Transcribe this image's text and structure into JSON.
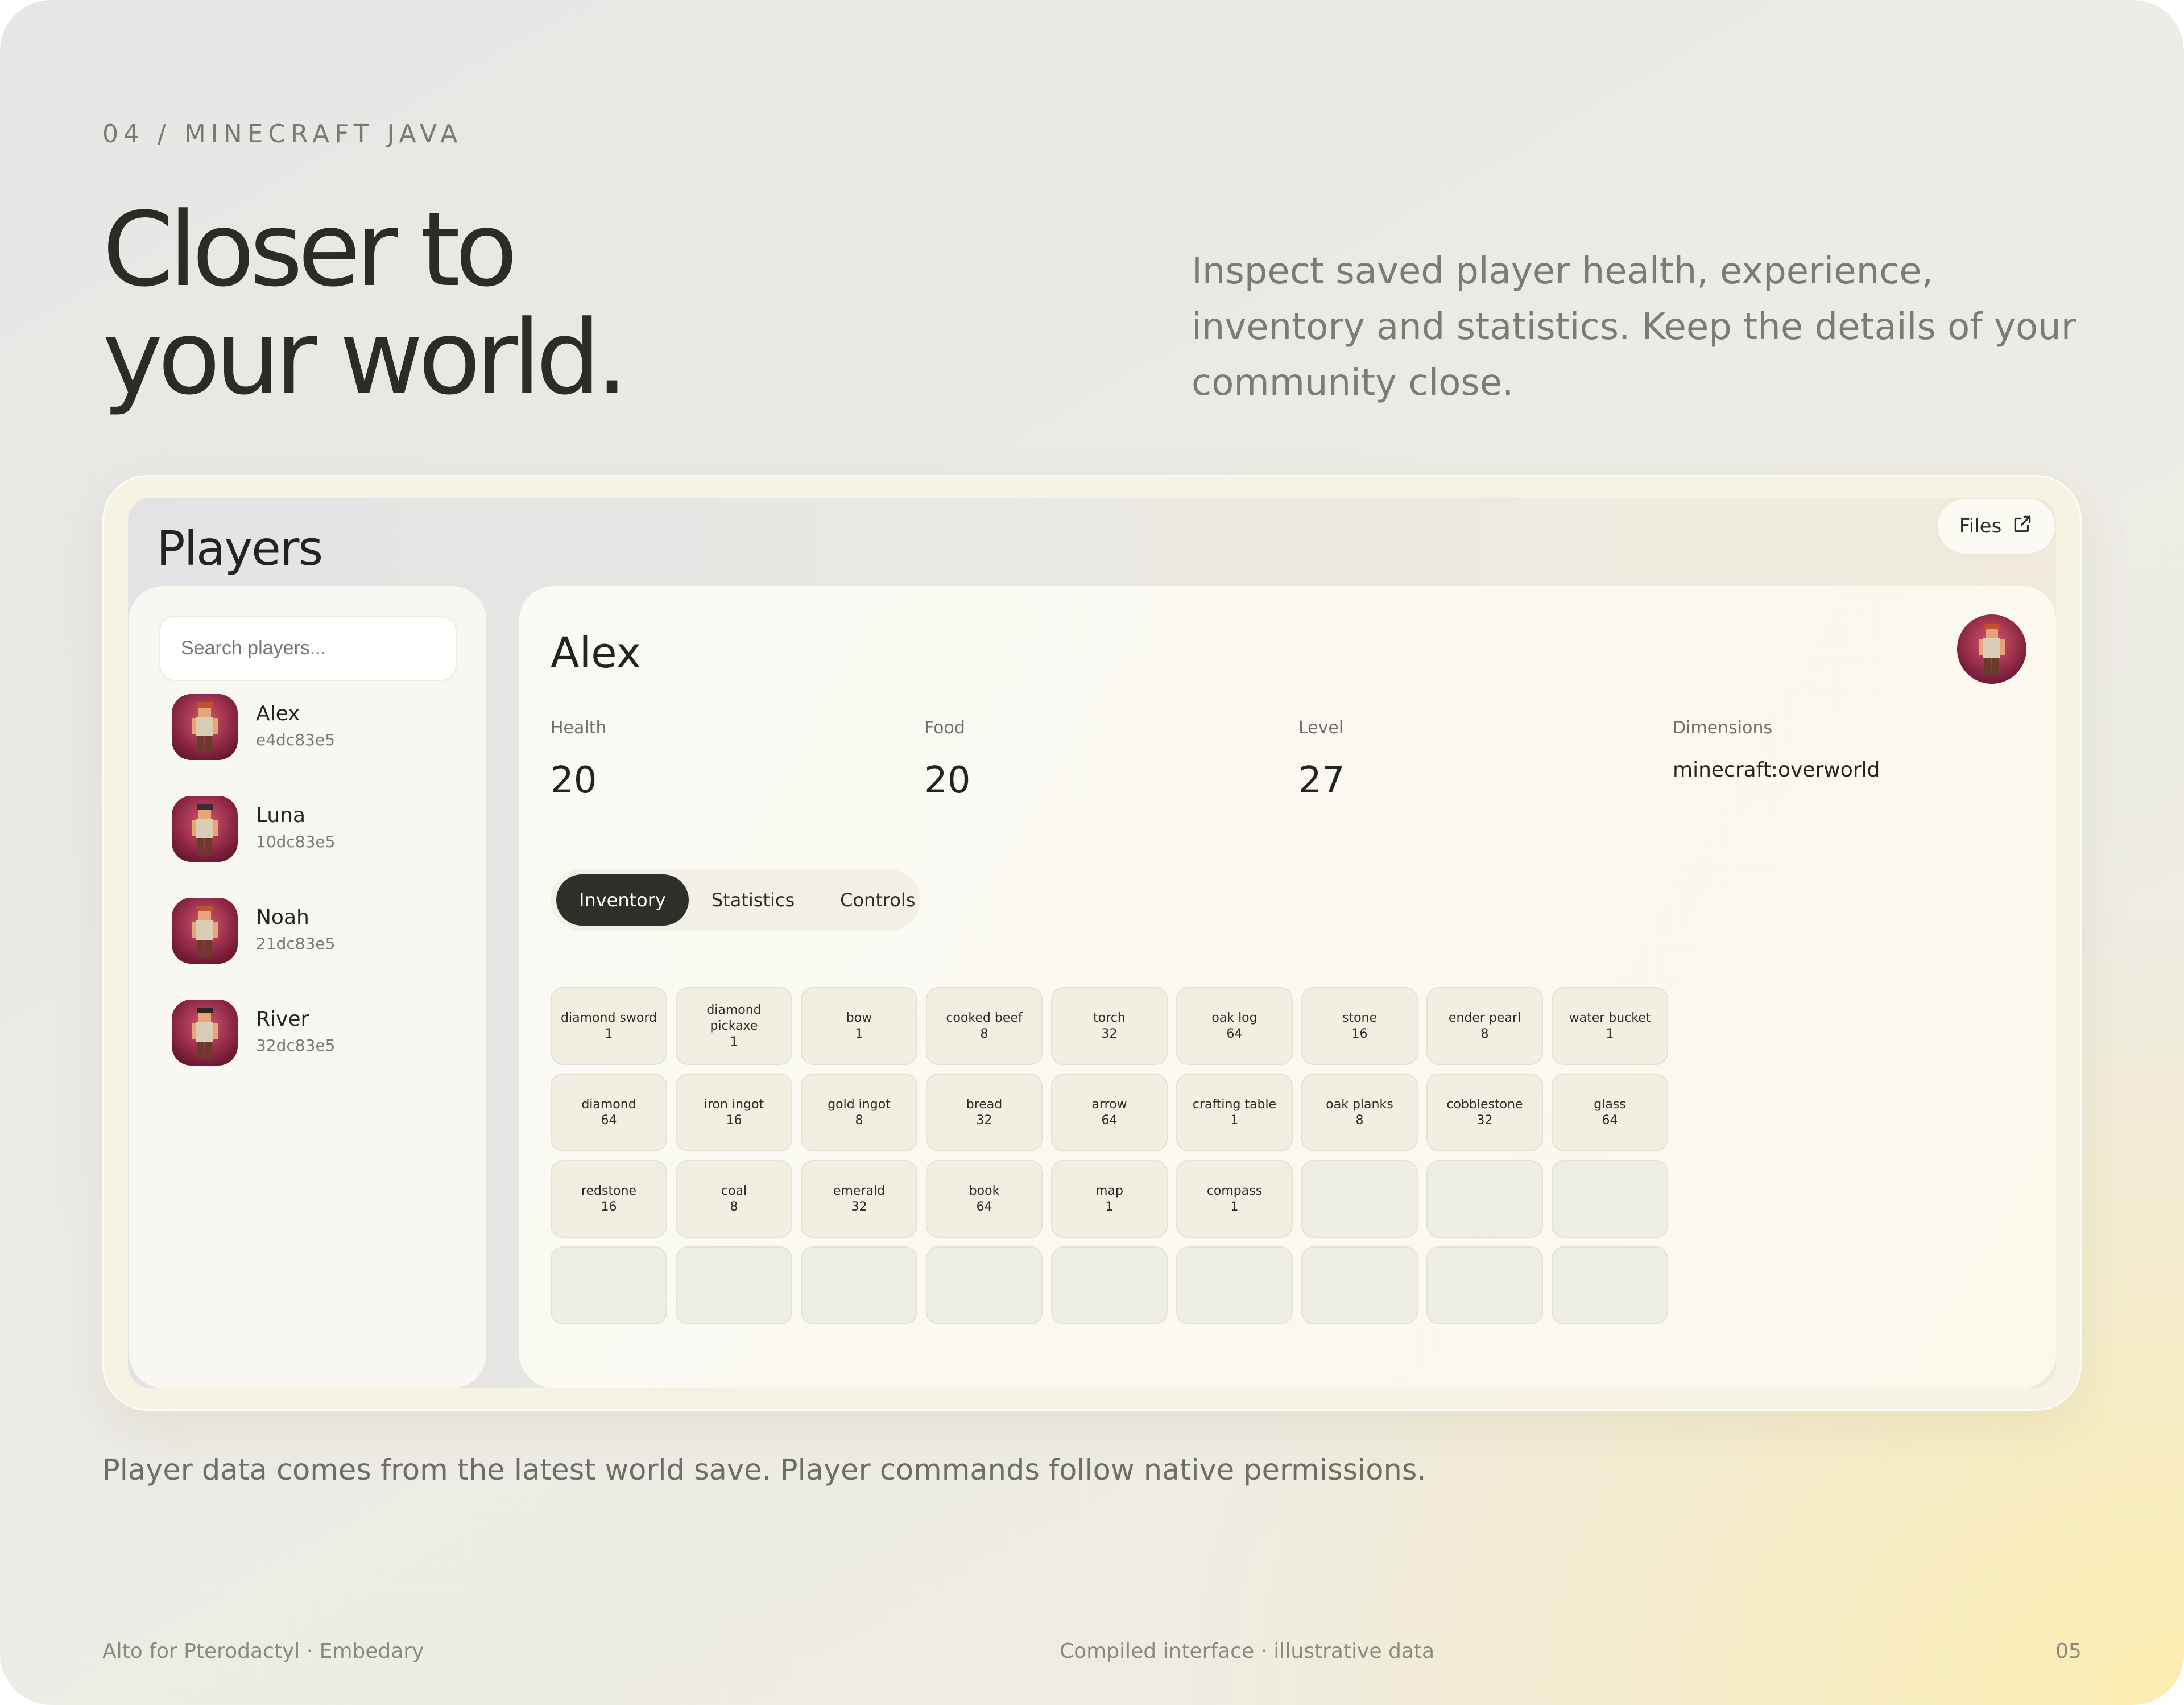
{
  "eyebrow": "04 / MINECRAFT JAVA",
  "headline": {
    "line1": "Closer to",
    "line2": "your world."
  },
  "intro": "Inspect saved player health, experience, inventory and statistics. Keep the details of your community close.",
  "panel": {
    "title": "Players",
    "files_label": "Files",
    "search_placeholder": "Search players...",
    "players": [
      {
        "name": "Alex",
        "id": "e4dc83e5"
      },
      {
        "name": "Luna",
        "id": "10dc83e5"
      },
      {
        "name": "Noah",
        "id": "21dc83e5"
      },
      {
        "name": "River",
        "id": "32dc83e5"
      }
    ],
    "selected": {
      "name": "Alex",
      "stats": {
        "health": {
          "label": "Health",
          "value": "20"
        },
        "food": {
          "label": "Food",
          "value": "20"
        },
        "level": {
          "label": "Level",
          "value": "27"
        },
        "dimensions": {
          "label": "Dimensions",
          "value": "minecraft:overworld"
        }
      },
      "tabs": [
        "Inventory",
        "Statistics",
        "Controls"
      ],
      "active_tab": "Inventory",
      "inventory": [
        {
          "name": "diamond sword",
          "count": "1"
        },
        {
          "name": "diamond pickaxe",
          "count": "1"
        },
        {
          "name": "bow",
          "count": "1"
        },
        {
          "name": "cooked beef",
          "count": "8"
        },
        {
          "name": "torch",
          "count": "32"
        },
        {
          "name": "oak log",
          "count": "64"
        },
        {
          "name": "stone",
          "count": "16"
        },
        {
          "name": "ender pearl",
          "count": "8"
        },
        {
          "name": "water bucket",
          "count": "1"
        },
        {
          "name": "diamond",
          "count": "64"
        },
        {
          "name": "iron ingot",
          "count": "16"
        },
        {
          "name": "gold ingot",
          "count": "8"
        },
        {
          "name": "bread",
          "count": "32"
        },
        {
          "name": "arrow",
          "count": "64"
        },
        {
          "name": "crafting table",
          "count": "1"
        },
        {
          "name": "oak planks",
          "count": "8"
        },
        {
          "name": "cobblestone",
          "count": "32"
        },
        {
          "name": "glass",
          "count": "64"
        },
        {
          "name": "redstone",
          "count": "16"
        },
        {
          "name": "coal",
          "count": "8"
        },
        {
          "name": "emerald",
          "count": "32"
        },
        {
          "name": "book",
          "count": "64"
        },
        {
          "name": "map",
          "count": "1"
        },
        {
          "name": "compass",
          "count": "1"
        }
      ],
      "inventory_slots_total": 36
    }
  },
  "note": "Player data comes from the latest world save. Player commands follow native permissions.",
  "footer": {
    "left": "Alto for Pterodactyl · Embedary",
    "center": "Compiled interface · illustrative data",
    "right": "05"
  },
  "icons": {
    "files": "external-link-icon",
    "avatar": "minecraft-player-avatar"
  }
}
